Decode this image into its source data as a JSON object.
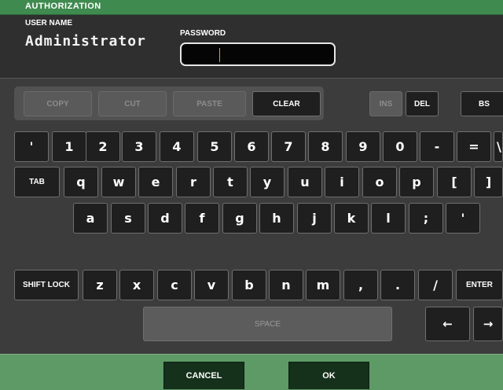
{
  "window": {
    "title": "AUTHORIZATION"
  },
  "header": {
    "user_name_label": "USER NAME",
    "user_name_value": "Administrator",
    "password_label": "PASSWORD",
    "password_value": ""
  },
  "edit_keys": {
    "copy": "COPY",
    "cut": "CUT",
    "paste": "PASTE",
    "clear": "CLEAR",
    "ins": "INS",
    "del": "DEL",
    "bs": "BS"
  },
  "keyboard": {
    "row1": [
      "'",
      "1",
      "2",
      "3",
      "4",
      "5",
      "6",
      "7",
      "8",
      "9",
      "0",
      "-",
      "=",
      "\\"
    ],
    "tab": "TAB",
    "row2": [
      "q",
      "w",
      "e",
      "r",
      "t",
      "y",
      "u",
      "i",
      "o",
      "p",
      "[",
      "]"
    ],
    "row3": [
      "a",
      "s",
      "d",
      "f",
      "g",
      "h",
      "j",
      "k",
      "l",
      ";",
      "'"
    ],
    "shift_lock": "SHIFT LOCK",
    "row4": [
      "z",
      "x",
      "c",
      "v",
      "b",
      "n",
      "m",
      ",",
      ".",
      "/"
    ],
    "enter": "ENTER",
    "space": "SPACE",
    "left_arrow": "←",
    "right_arrow": "→"
  },
  "footer": {
    "cancel": "CANCEL",
    "ok": "OK"
  },
  "colors": {
    "titlebar": "#3f8a4f",
    "footer": "#5e9a66",
    "key_bg": "#1f1f1f",
    "disabled_key_bg": "#5a5a5a",
    "panel_bg": "#3c3c3c"
  }
}
